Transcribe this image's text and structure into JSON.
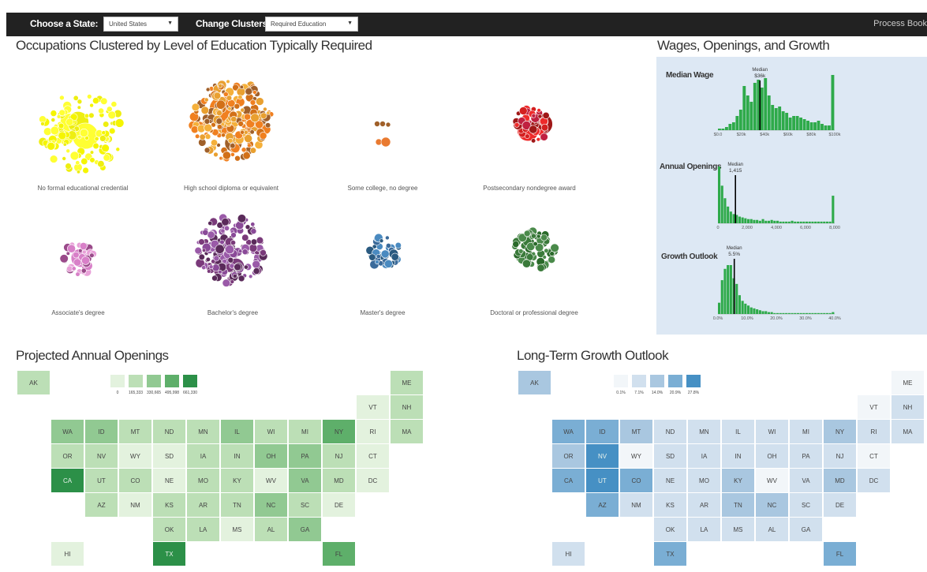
{
  "topbar": {
    "state_label": "Choose a State:",
    "state_value": "United States",
    "clusters_label": "Change Clusters:",
    "clusters_value": "Required Education",
    "process_link": "Process Book"
  },
  "titles": {
    "clusters": "Occupations Clustered by Level of Education Typically Required",
    "histograms": "Wages, Openings, and Growth",
    "openings_map": "Projected Annual Openings",
    "growth_map": "Long-Term Growth Outlook"
  },
  "clusters": [
    {
      "label": "No formal educational credential",
      "colors": [
        "#f5f500",
        "#eeee10",
        "#ffff33"
      ]
    },
    {
      "label": "High school diploma or equivalent",
      "colors": [
        "#f08020",
        "#e9a030",
        "#d27018",
        "#a0602a",
        "#f5b03a"
      ]
    },
    {
      "label": "Some college, no degree",
      "colors": [
        "#a0602a",
        "#e97a30"
      ]
    },
    {
      "label": "Postsecondary nondegree award",
      "colors": [
        "#d42020",
        "#ee2a2a",
        "#a01818",
        "#c02040"
      ]
    },
    {
      "label": "Associate's degree",
      "colors": [
        "#d880c8",
        "#9a4a8a",
        "#e8a0d8"
      ]
    },
    {
      "label": "Bachelor's degree",
      "colors": [
        "#7a3a7a",
        "#9a5aa8",
        "#5a2a5a",
        "#8a4a98"
      ]
    },
    {
      "label": "Master's degree",
      "colors": [
        "#3a6a9a",
        "#4a8ac0",
        "#2a5a80"
      ]
    },
    {
      "label": "Doctoral or professional degree",
      "colors": [
        "#3a7a3a",
        "#2a6a2a",
        "#4a8a4a"
      ]
    }
  ],
  "histograms": [
    {
      "title": "Median Wage",
      "median_label": "Median",
      "median_value": "$36k",
      "median_fraction": 0.36,
      "ticks": [
        "$0.0",
        "$20k",
        "$40k",
        "$60k",
        "$80k",
        "$100k"
      ],
      "bars": [
        1,
        1,
        2,
        4,
        5,
        9,
        13,
        28,
        22,
        18,
        30,
        32,
        27,
        33,
        22,
        16,
        14,
        15,
        12,
        11,
        8,
        9,
        9,
        8,
        7,
        6,
        5,
        5,
        6,
        4,
        3,
        3,
        35
      ]
    },
    {
      "title": "Annual Openings",
      "median_label": "Median",
      "median_value": "1,415",
      "median_fraction": 0.15,
      "ticks": [
        "0",
        "2,000",
        "4,000",
        "6,000",
        "8,000"
      ],
      "bars": [
        68,
        45,
        30,
        20,
        14,
        11,
        10,
        8,
        7,
        6,
        5,
        5,
        4,
        4,
        3,
        5,
        3,
        3,
        4,
        3,
        3,
        2,
        2,
        2,
        2,
        3,
        2,
        2,
        2,
        2,
        2,
        2,
        2,
        2,
        2,
        2,
        2,
        2,
        2,
        33
      ]
    },
    {
      "title": "Growth Outlook",
      "median_label": "Median",
      "median_value": "5.5%",
      "median_fraction": 0.14,
      "ticks": [
        "0.0%",
        "10.0%",
        "20.0%",
        "30.0%",
        "40.0%"
      ],
      "bars": [
        12,
        36,
        48,
        52,
        52,
        38,
        32,
        20,
        14,
        11,
        9,
        7,
        6,
        5,
        4,
        3,
        3,
        2,
        2,
        1,
        1,
        1,
        1,
        1,
        1,
        1,
        1,
        1,
        1,
        1,
        1,
        1,
        1,
        1,
        1,
        1,
        1,
        1,
        1,
        2
      ]
    }
  ],
  "openings_legend": {
    "labels": [
      "0",
      "165,333",
      "330,665",
      "495,998",
      "661,330"
    ],
    "colors": [
      "#e3f2de",
      "#bcdfb6",
      "#91c992",
      "#5eaf6a",
      "#2c9048"
    ]
  },
  "growth_legend": {
    "labels": [
      "0.1%",
      "7.1%",
      "14.0%",
      "20.9%",
      "27.8%"
    ],
    "colors": [
      "#f2f6f9",
      "#d1e0ee",
      "#a9c7e0",
      "#7aaed4",
      "#4690c4"
    ]
  },
  "states": [
    {
      "code": "AK",
      "row": 0,
      "col": 0,
      "open": 1,
      "grow": 2
    },
    {
      "code": "ME",
      "row": 0,
      "col": 11,
      "open": 1,
      "grow": 0
    },
    {
      "code": "VT",
      "row": 1,
      "col": 10,
      "open": 0,
      "grow": 0
    },
    {
      "code": "NH",
      "row": 1,
      "col": 11,
      "open": 1,
      "grow": 1
    },
    {
      "code": "WA",
      "row": 2,
      "col": 1,
      "open": 2,
      "grow": 3
    },
    {
      "code": "ID",
      "row": 2,
      "col": 2,
      "open": 2,
      "grow": 3
    },
    {
      "code": "MT",
      "row": 2,
      "col": 3,
      "open": 1,
      "grow": 2
    },
    {
      "code": "ND",
      "row": 2,
      "col": 4,
      "open": 1,
      "grow": 1
    },
    {
      "code": "MN",
      "row": 2,
      "col": 5,
      "open": 1,
      "grow": 1
    },
    {
      "code": "IL",
      "row": 2,
      "col": 6,
      "open": 2,
      "grow": 1
    },
    {
      "code": "WI",
      "row": 2,
      "col": 7,
      "open": 1,
      "grow": 1
    },
    {
      "code": "MI",
      "row": 2,
      "col": 8,
      "open": 1,
      "grow": 1
    },
    {
      "code": "NY",
      "row": 2,
      "col": 9,
      "open": 3,
      "grow": 2
    },
    {
      "code": "RI",
      "row": 2,
      "col": 10,
      "open": 0,
      "grow": 1
    },
    {
      "code": "MA",
      "row": 2,
      "col": 11,
      "open": 1,
      "grow": 1
    },
    {
      "code": "OR",
      "row": 3,
      "col": 1,
      "open": 1,
      "grow": 2
    },
    {
      "code": "NV",
      "row": 3,
      "col": 2,
      "open": 1,
      "grow": 4
    },
    {
      "code": "WY",
      "row": 3,
      "col": 3,
      "open": 0,
      "grow": 0
    },
    {
      "code": "SD",
      "row": 3,
      "col": 4,
      "open": 0,
      "grow": 1
    },
    {
      "code": "IA",
      "row": 3,
      "col": 5,
      "open": 1,
      "grow": 1
    },
    {
      "code": "IN",
      "row": 3,
      "col": 6,
      "open": 1,
      "grow": 1
    },
    {
      "code": "OH",
      "row": 3,
      "col": 7,
      "open": 2,
      "grow": 1
    },
    {
      "code": "PA",
      "row": 3,
      "col": 8,
      "open": 2,
      "grow": 1
    },
    {
      "code": "NJ",
      "row": 3,
      "col": 9,
      "open": 1,
      "grow": 1
    },
    {
      "code": "CT",
      "row": 3,
      "col": 10,
      "open": 0,
      "grow": 0
    },
    {
      "code": "CA",
      "row": 4,
      "col": 1,
      "open": 4,
      "grow": 3
    },
    {
      "code": "UT",
      "row": 4,
      "col": 2,
      "open": 1,
      "grow": 4
    },
    {
      "code": "CO",
      "row": 4,
      "col": 3,
      "open": 1,
      "grow": 3
    },
    {
      "code": "NE",
      "row": 4,
      "col": 4,
      "open": 0,
      "grow": 1
    },
    {
      "code": "MO",
      "row": 4,
      "col": 5,
      "open": 1,
      "grow": 1
    },
    {
      "code": "KY",
      "row": 4,
      "col": 6,
      "open": 1,
      "grow": 2
    },
    {
      "code": "WV",
      "row": 4,
      "col": 7,
      "open": 0,
      "grow": 0
    },
    {
      "code": "VA",
      "row": 4,
      "col": 8,
      "open": 2,
      "grow": 1
    },
    {
      "code": "MD",
      "row": 4,
      "col": 9,
      "open": 1,
      "grow": 2
    },
    {
      "code": "DC",
      "row": 4,
      "col": 10,
      "open": 0,
      "grow": 1
    },
    {
      "code": "AZ",
      "row": 5,
      "col": 2,
      "open": 1,
      "grow": 3
    },
    {
      "code": "NM",
      "row": 5,
      "col": 3,
      "open": 0,
      "grow": 1
    },
    {
      "code": "KS",
      "row": 5,
      "col": 4,
      "open": 1,
      "grow": 1
    },
    {
      "code": "AR",
      "row": 5,
      "col": 5,
      "open": 1,
      "grow": 1
    },
    {
      "code": "TN",
      "row": 5,
      "col": 6,
      "open": 1,
      "grow": 2
    },
    {
      "code": "NC",
      "row": 5,
      "col": 7,
      "open": 2,
      "grow": 2
    },
    {
      "code": "SC",
      "row": 5,
      "col": 8,
      "open": 1,
      "grow": 1
    },
    {
      "code": "DE",
      "row": 5,
      "col": 9,
      "open": 0,
      "grow": 1
    },
    {
      "code": "OK",
      "row": 6,
      "col": 4,
      "open": 1,
      "grow": 1
    },
    {
      "code": "LA",
      "row": 6,
      "col": 5,
      "open": 1,
      "grow": 1
    },
    {
      "code": "MS",
      "row": 6,
      "col": 6,
      "open": 0,
      "grow": 1
    },
    {
      "code": "AL",
      "row": 6,
      "col": 7,
      "open": 1,
      "grow": 1
    },
    {
      "code": "GA",
      "row": 6,
      "col": 8,
      "open": 2,
      "grow": 1
    },
    {
      "code": "HI",
      "row": 7,
      "col": 1,
      "open": 0,
      "grow": 1
    },
    {
      "code": "TX",
      "row": 7,
      "col": 4,
      "open": 4,
      "grow": 3
    },
    {
      "code": "FL",
      "row": 7,
      "col": 9,
      "open": 3,
      "grow": 3
    }
  ]
}
